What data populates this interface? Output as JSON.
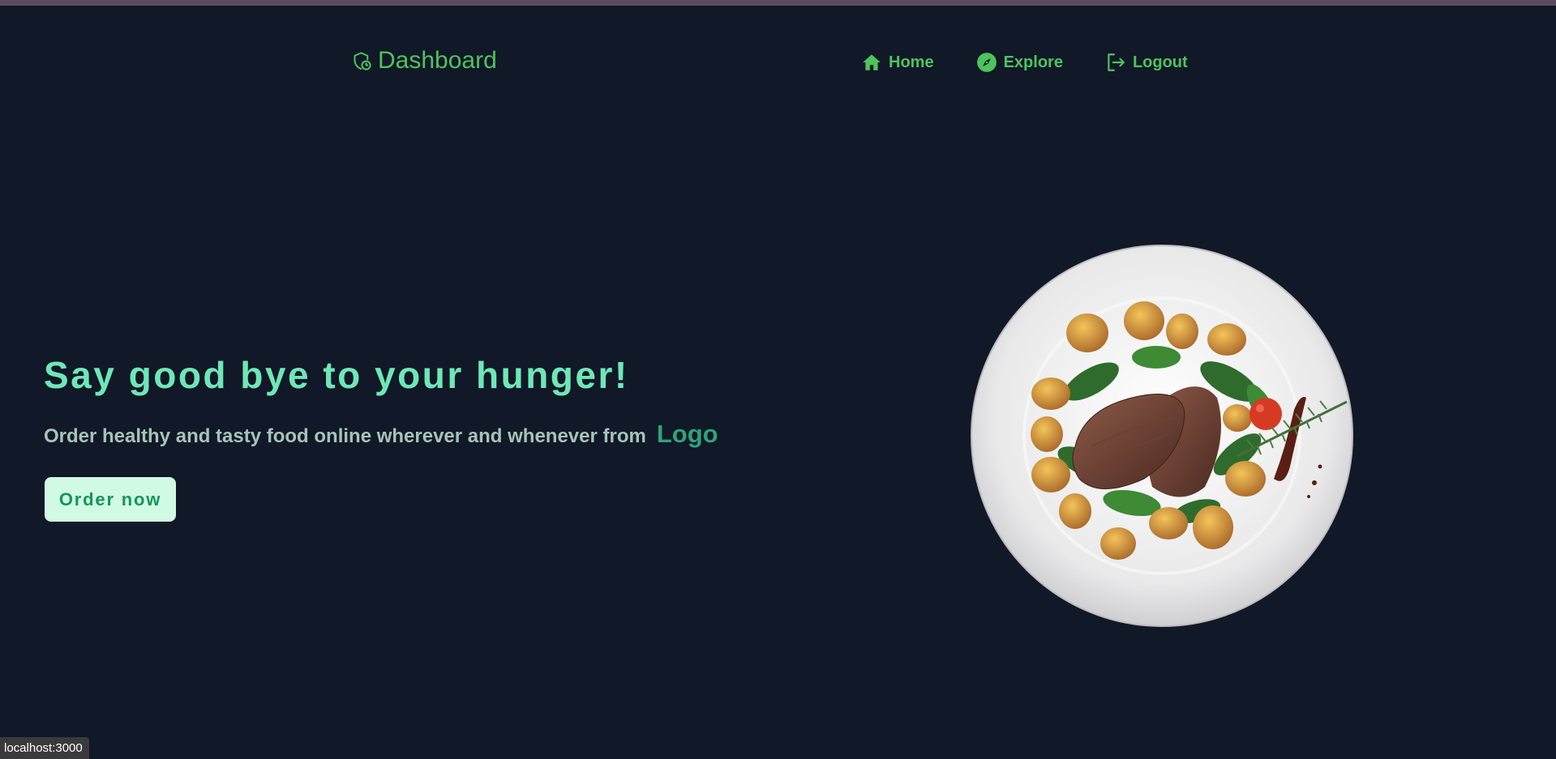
{
  "header": {
    "brand_label": "Dashboard",
    "brand_icon": "shield-clock-icon",
    "nav": [
      {
        "label": "Home",
        "icon": "home-icon"
      },
      {
        "label": "Explore",
        "icon": "compass-icon"
      },
      {
        "label": "Logout",
        "icon": "logout-icon"
      }
    ]
  },
  "hero": {
    "title": "Say good bye to your hunger!",
    "subtitle": "Order healthy and tasty food online wherever and whenever from",
    "logo_word": "Logo",
    "cta_label": "Order now",
    "image_icon": "steak-plate-illustration"
  },
  "status_bar": {
    "url": "localhost:3000"
  },
  "colors": {
    "background": "#111827",
    "accent_green": "#4ec35e",
    "title_mint": "#6ee7b7",
    "button_bg": "#d1fae5",
    "button_text": "#15955a"
  }
}
